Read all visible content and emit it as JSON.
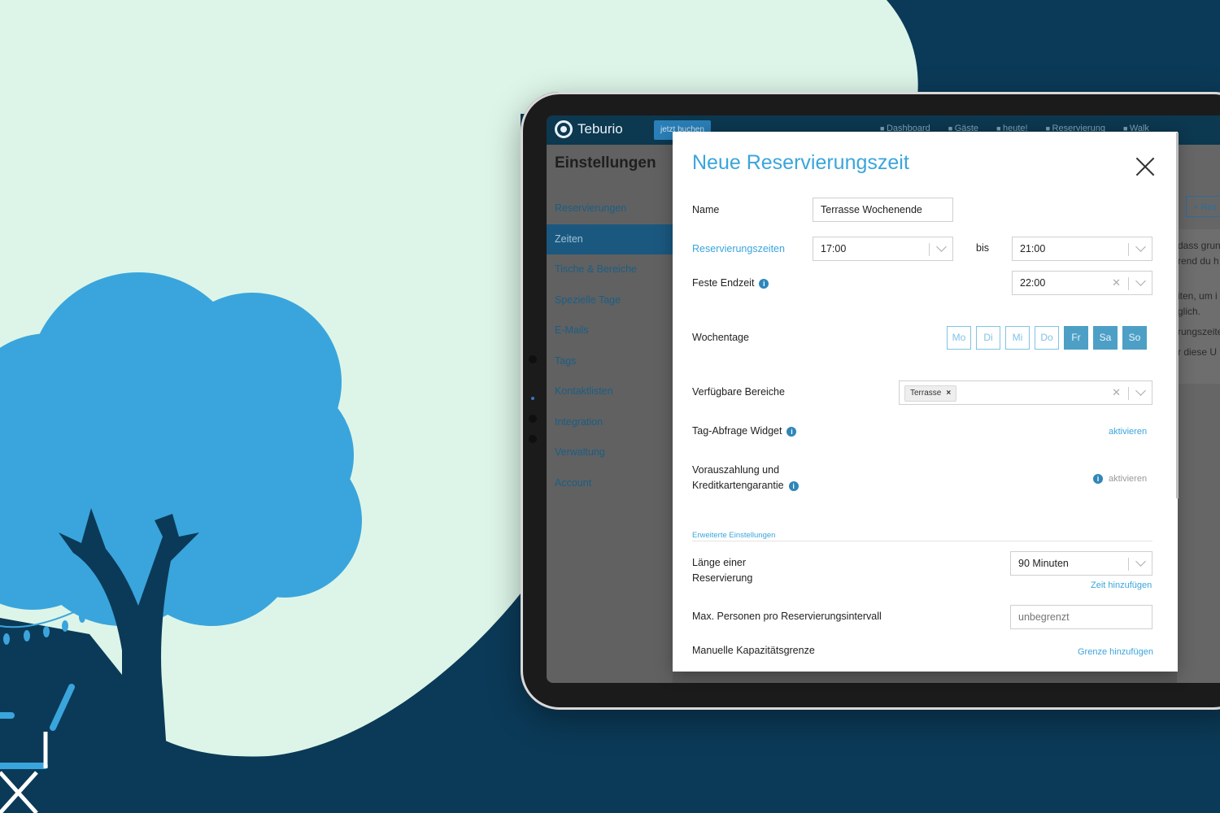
{
  "colors": {
    "background_dark": "#0b3a58",
    "background_light": "#ddf5e8",
    "tree_foliage": "#3aa5dc",
    "accent": "#3aa5dc",
    "day_active": "#4d9fc6"
  },
  "app": {
    "name": "Teburio",
    "book_button": "jetzt buchen",
    "nav": [
      "Dashboard",
      "Gäste",
      "heute!",
      "Reservierung",
      "Walk"
    ]
  },
  "sidebar": {
    "title": "Einstellungen",
    "items": [
      {
        "label": "Reservierungen",
        "active": false
      },
      {
        "label": "Zeiten",
        "active": true
      },
      {
        "label": "Tische & Bereiche",
        "active": false
      },
      {
        "label": "Spezielle Tage",
        "active": false
      },
      {
        "label": "E-Mails",
        "active": false
      },
      {
        "label": "Tags",
        "active": false
      },
      {
        "label": "Kontaktlisten",
        "active": false
      },
      {
        "label": "Integration",
        "active": false
      },
      {
        "label": "Verwaltung",
        "active": false
      },
      {
        "label": "Account",
        "active": false
      }
    ]
  },
  "background_page": {
    "add_button": "+ Res",
    "text_lines": [
      "dass grun",
      "rend du h",
      "iten, um i",
      "glich.",
      "rungszeite",
      "r diese U"
    ]
  },
  "modal": {
    "title": "Neue Reservierungszeit",
    "name": {
      "label": "Name",
      "value": "Terrasse Wochenende"
    },
    "times": {
      "label": "Reservierungszeiten",
      "from": "17:00",
      "separator": "bis",
      "to": "21:00"
    },
    "fixed_end": {
      "label": "Feste Endzeit",
      "value": "22:00"
    },
    "weekdays": {
      "label": "Wochentage",
      "days": [
        {
          "label": "Mo",
          "active": false
        },
        {
          "label": "Di",
          "active": false
        },
        {
          "label": "Mi",
          "active": false
        },
        {
          "label": "Do",
          "active": false
        },
        {
          "label": "Fr",
          "active": true
        },
        {
          "label": "Sa",
          "active": true
        },
        {
          "label": "So",
          "active": true
        }
      ]
    },
    "areas": {
      "label": "Verfügbare Bereiche",
      "tags": [
        "Terrasse"
      ]
    },
    "tag_widget": {
      "label": "Tag-Abfrage Widget",
      "action": "aktivieren"
    },
    "prepayment": {
      "label_line1": "Vorauszahlung und",
      "label_line2": "Kreditkartengarantie",
      "action": "aktivieren"
    },
    "advanced": {
      "heading": "Erweiterte Einstellungen",
      "duration": {
        "label_line1": "Länge einer",
        "label_line2": "Reservierung",
        "value": "90 Minuten",
        "action": "Zeit hinzufügen"
      },
      "max_persons": {
        "label": "Max. Personen pro Reservierungsintervall",
        "placeholder": "unbegrenzt"
      },
      "capacity": {
        "label": "Manuelle Kapazitätsgrenze",
        "action": "Grenze hinzufügen"
      }
    }
  }
}
